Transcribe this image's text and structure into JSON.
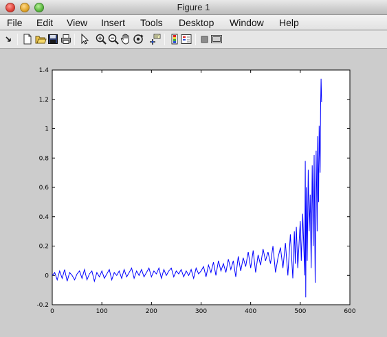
{
  "window": {
    "title": "Figure 1",
    "controls": [
      "close-icon",
      "minimize-icon",
      "zoom-icon"
    ]
  },
  "menubar": {
    "items": [
      "File",
      "Edit",
      "View",
      "Insert",
      "Tools",
      "Desktop",
      "Window",
      "Help"
    ]
  },
  "toolbar": {
    "icons": [
      "dock-arrow-icon",
      "new-figure-icon",
      "open-file-icon",
      "save-figure-icon",
      "print-figure-icon",
      "edit-plot-arrow-icon",
      "zoom-in-icon",
      "zoom-out-icon",
      "pan-hand-icon",
      "rotate-3d-icon",
      "data-cursor-icon",
      "insert-colorbar-icon",
      "insert-legend-icon",
      "hide-plot-tools-icon",
      "show-plot-tools-icon"
    ]
  },
  "chart_data": {
    "type": "line",
    "title": "",
    "xlabel": "",
    "ylabel": "",
    "xlim": [
      0,
      600
    ],
    "ylim": [
      -0.2,
      1.4
    ],
    "xticks": [
      0,
      100,
      200,
      300,
      400,
      500,
      600
    ],
    "yticks": [
      -0.2,
      0,
      0.2,
      0.4,
      0.6,
      0.8,
      1,
      1.2,
      1.4
    ],
    "grid": false,
    "line_color": "#0000ff",
    "series": [
      {
        "x": [
          0,
          5,
          10,
          15,
          20,
          25,
          30,
          35,
          40,
          45,
          50,
          55,
          60,
          65,
          70,
          75,
          80,
          85,
          90,
          95,
          100,
          105,
          110,
          115,
          120,
          125,
          130,
          135,
          140,
          145,
          150,
          155,
          160,
          165,
          170,
          175,
          180,
          185,
          190,
          195,
          200,
          205,
          210,
          215,
          220,
          225,
          230,
          235,
          240,
          245,
          250,
          255,
          260,
          265,
          270,
          275,
          280,
          285,
          290,
          295,
          300,
          305,
          310,
          315,
          320,
          325,
          330,
          335,
          340,
          345,
          350,
          355,
          360,
          365,
          370,
          375,
          380,
          385,
          390,
          395,
          400,
          405,
          410,
          415,
          420,
          425,
          430,
          435,
          440,
          445,
          450,
          455,
          460,
          465,
          470,
          475,
          480,
          485,
          488,
          490,
          492,
          495,
          498,
          500,
          502,
          505,
          507,
          509,
          510,
          511,
          512,
          514,
          516,
          518,
          520,
          522,
          524,
          526,
          528,
          530,
          532,
          534,
          535,
          537,
          538,
          540,
          541,
          542,
          543
        ],
        "y": [
          0.0,
          0.02,
          -0.03,
          0.03,
          -0.02,
          0.04,
          -0.04,
          0.02,
          0.0,
          -0.03,
          0.01,
          0.03,
          -0.02,
          0.04,
          -0.03,
          0.01,
          0.03,
          -0.04,
          0.02,
          -0.01,
          0.03,
          -0.02,
          0.01,
          0.04,
          -0.03,
          0.02,
          0.0,
          0.03,
          -0.02,
          0.04,
          -0.01,
          0.02,
          0.05,
          -0.02,
          0.03,
          0.0,
          0.04,
          -0.01,
          0.02,
          0.05,
          -0.01,
          0.03,
          0.01,
          0.05,
          -0.02,
          0.04,
          0.0,
          0.03,
          0.05,
          -0.01,
          0.03,
          0.01,
          0.04,
          -0.01,
          0.03,
          0.0,
          0.04,
          -0.02,
          0.05,
          0.01,
          0.03,
          0.06,
          -0.01,
          0.07,
          0.02,
          0.09,
          0.0,
          0.1,
          0.03,
          0.08,
          0.02,
          0.11,
          0.04,
          0.1,
          -0.01,
          0.13,
          0.03,
          0.12,
          0.06,
          0.16,
          0.05,
          0.17,
          0.02,
          0.14,
          0.07,
          0.18,
          0.1,
          0.16,
          0.08,
          0.2,
          0.02,
          0.12,
          0.19,
          0.05,
          0.22,
          0.0,
          0.28,
          -0.02,
          0.3,
          0.08,
          0.33,
          0.05,
          0.25,
          0.37,
          0.1,
          0.42,
          0.2,
          0.0,
          0.78,
          -0.15,
          0.6,
          0.1,
          0.72,
          0.3,
          0.55,
          0.05,
          0.75,
          0.2,
          0.82,
          -0.05,
          0.85,
          0.3,
          0.95,
          0.5,
          1.02,
          0.7,
          1.15,
          1.34,
          1.18
        ]
      }
    ]
  }
}
